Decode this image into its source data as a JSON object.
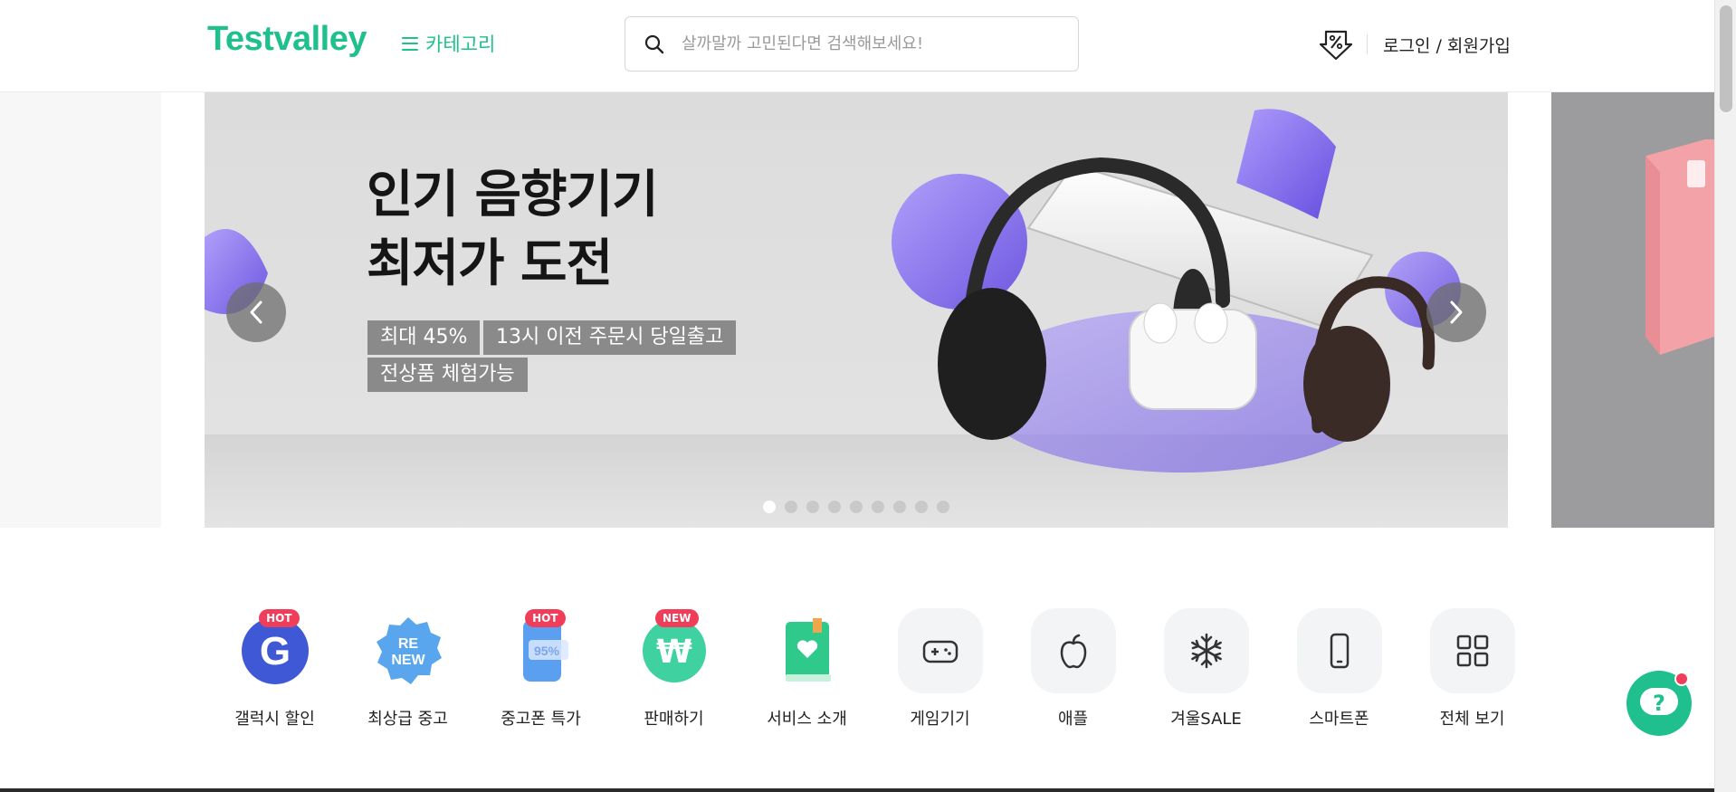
{
  "header": {
    "logo": "Testvalley",
    "category_label": "카테고리",
    "search_placeholder": "살까말까 고민된다면 검색해보세요!",
    "login_label": "로그인 / 회원가입"
  },
  "banner": {
    "headline_line1": "인기 음향기기",
    "headline_line2": "최저가 도전",
    "tags": [
      "최대 45%",
      "13시 이전 주문시 당일출고",
      "전상품 체험가능"
    ],
    "slide_count": 9,
    "active_slide": 1
  },
  "quick_menu": [
    {
      "label": "갤럭시 할인",
      "icon": "galaxy-g-icon",
      "badge": "HOT"
    },
    {
      "label": "최상급 중고",
      "icon": "renew-icon",
      "badge": ""
    },
    {
      "label": "중고폰 특가",
      "icon": "used-phone-icon",
      "badge": "HOT"
    },
    {
      "label": "판매하기",
      "icon": "won-sell-icon",
      "badge": "NEW"
    },
    {
      "label": "서비스 소개",
      "icon": "book-heart-icon",
      "badge": ""
    },
    {
      "label": "게임기기",
      "icon": "gamepad-icon",
      "badge": ""
    },
    {
      "label": "애플",
      "icon": "apple-icon",
      "badge": ""
    },
    {
      "label": "겨울SALE",
      "icon": "snowflake-icon",
      "badge": ""
    },
    {
      "label": "스마트폰",
      "icon": "smartphone-icon",
      "badge": ""
    },
    {
      "label": "전체 보기",
      "icon": "grid-icon",
      "badge": ""
    }
  ],
  "help": {
    "label": "?"
  },
  "colors": {
    "brand": "#1fc08e",
    "badge": "#f03e5a"
  }
}
